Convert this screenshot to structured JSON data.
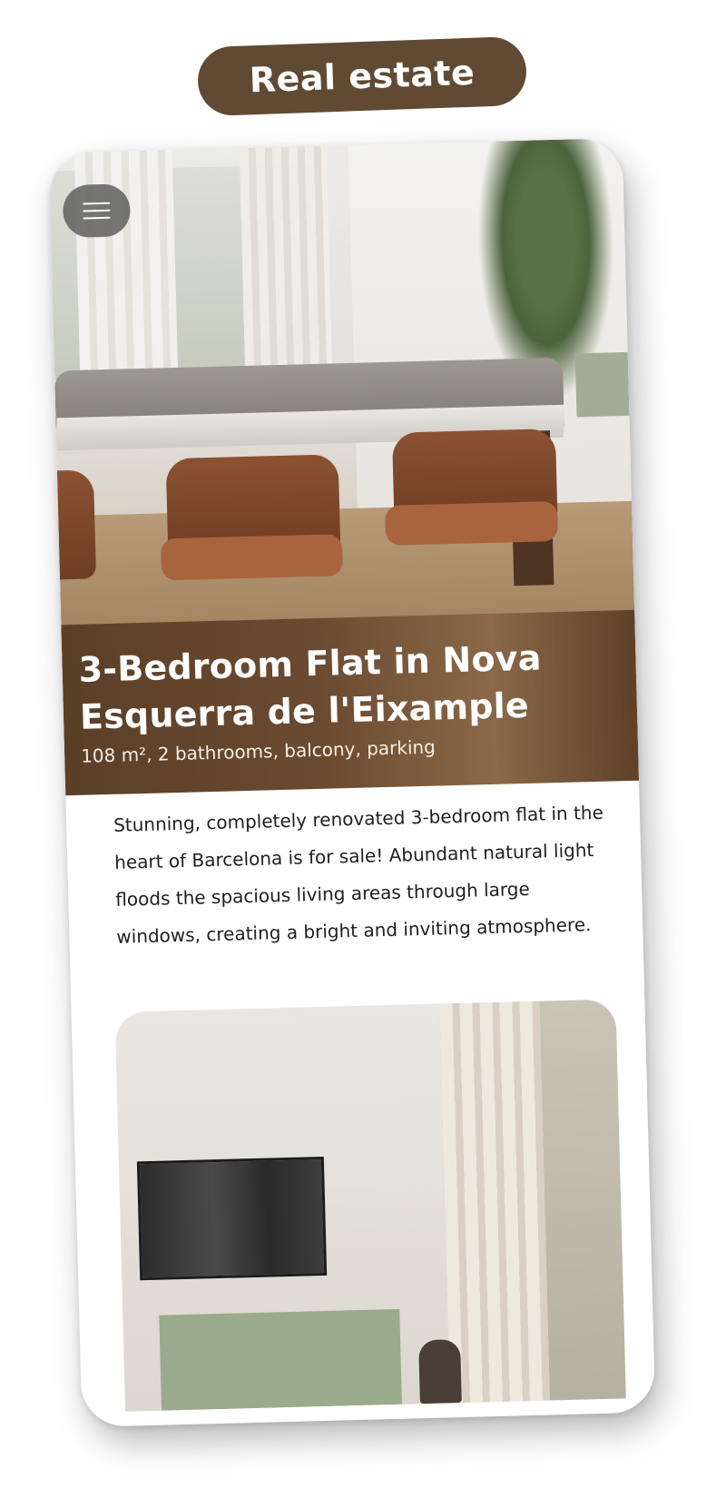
{
  "badge": {
    "label": "Real estate"
  },
  "listing": {
    "title": "3-Bedroom Flat in Nova Esquerra de l'Eixample",
    "subtitle": "108 m², 2 bathrooms, balcony, parking",
    "description": "Stunning, completely renovated 3-bedroom flat in the heart of Barcelona is for sale! Abundant natural light floods the spacious living areas through large windows, creating a bright and inviting atmosphere."
  },
  "icons": {
    "menu": "hamburger-menu-icon"
  },
  "colors": {
    "brand_brown": "#604a34",
    "title_band": "#6b4a30",
    "text": "#1f1f1f",
    "background": "#ffffff"
  }
}
